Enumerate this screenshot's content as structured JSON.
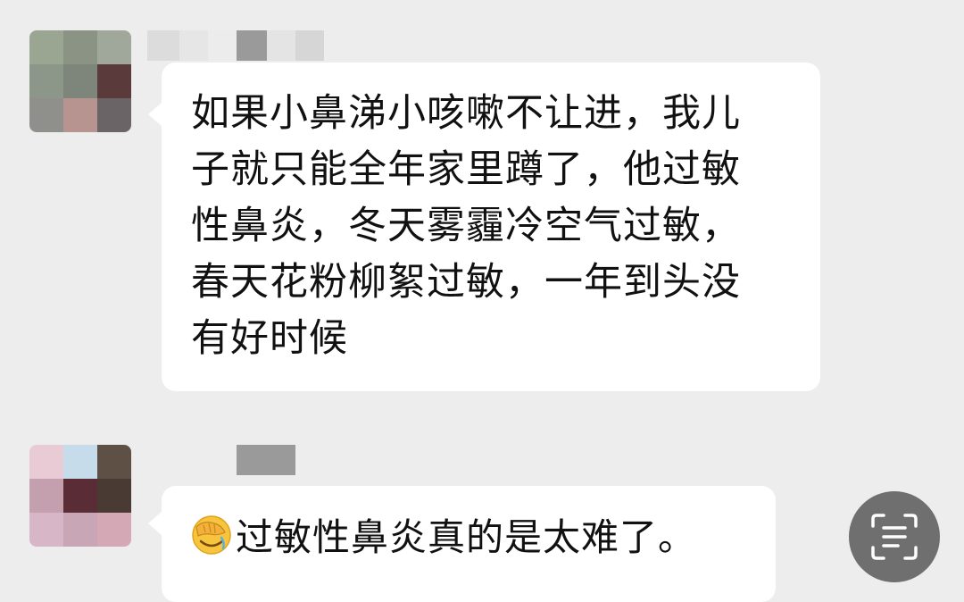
{
  "chat": {
    "messages": [
      {
        "lines": [
          "如果小鼻涕小咳嗽不让进，我儿",
          "子就只能全年家里蹲了，他过敏",
          "性鼻炎，冬天雾霾冷空气过敏，",
          "春天花粉柳絮过敏，一年到头没",
          "有好时候"
        ]
      },
      {
        "emoji": "face-with-hand-over-eyes-emoji",
        "text": "过敏性鼻炎真的是太难了。"
      }
    ]
  },
  "toolbar": {
    "scan_icon": "scan-text-icon"
  },
  "colors": {
    "background": "#ededed",
    "bubble": "#ffffff",
    "text": "#111111",
    "scan_button": "#6f6f6f"
  }
}
